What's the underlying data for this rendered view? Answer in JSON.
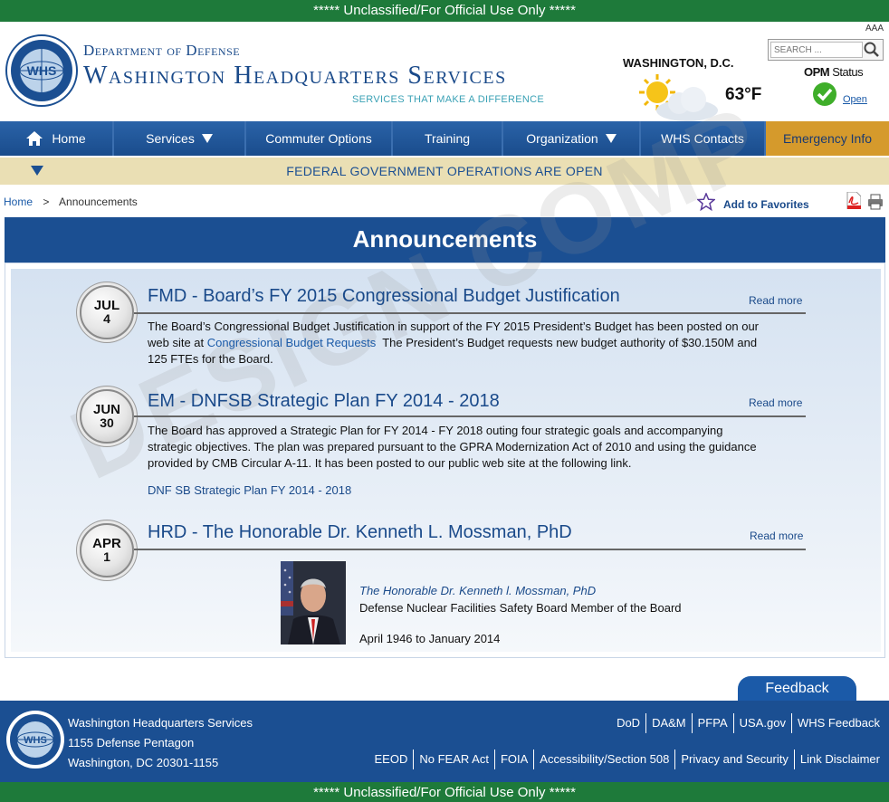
{
  "classification": "***** Unclassified/For Official Use Only *****",
  "header": {
    "dept": "Department of Defense",
    "title": "Washington Headquarters Services",
    "tagline": "SERVICES THAT MAKE A DIFFERENCE",
    "text_size": "AAA",
    "search_placeholder": "SEARCH ...",
    "weather": {
      "city": "WASHINGTON, D.C.",
      "temp": "63°F"
    },
    "opm": {
      "label": "OPM",
      "status_word": "Status",
      "value": "Open"
    }
  },
  "nav": {
    "items": [
      {
        "label": "Home",
        "width": 126
      },
      {
        "label": "Services",
        "width": 146
      },
      {
        "label": "Commuter Options",
        "width": 162
      },
      {
        "label": "Training",
        "width": 122
      },
      {
        "label": "Organization",
        "width": 152
      },
      {
        "label": "WHS Contacts",
        "width": 138
      },
      {
        "label": "Emergency Info",
        "width": 136
      }
    ]
  },
  "status_bar": "FEDERAL GOVERNMENT OPERATIONS ARE OPEN",
  "breadcrumb": {
    "home": "Home",
    "sep": ">",
    "current": "Announcements"
  },
  "favorites_label": "Add to Favorites",
  "panel_title": "Announcements",
  "watermark": "DESIGN COMP",
  "announcements": [
    {
      "month": "JUL",
      "day": "4",
      "title": "FMD - Board’s FY 2015 Congressional Budget Justification",
      "read_more": "Read more",
      "line1": "The Board’s Congressional Budget Justification in support of the FY 2015 President’s Budget has been posted on our",
      "line2_pre": "web site at ",
      "line2_link": "Congressional Budget Requests",
      "line2_post": "  The President’s Budget requests new budget authority of $30.150M and",
      "line3": "125 FTEs for the Board."
    },
    {
      "month": "JUN",
      "day": "30",
      "title": "EM - DNFSB Strategic Plan FY 2014 - 2018",
      "read_more": "Read more",
      "line1": "The Board has approved a Strategic Plan for FY 2014 - FY 2018 outing four strategic goals and accompanying",
      "line2": "strategic objectives. The plan was prepared pursuant to the GPRA Modernization Act of 2010 and using the guidance",
      "line3": "provided by CMB Circular A-11. It has been posted to our public web site at the following link.",
      "link": "DNF SB Strategic Plan FY 2014 - 2018"
    },
    {
      "month": "APR",
      "day": "1",
      "title": "HRD - The Honorable Dr. Kenneth L. Mossman,  PhD",
      "read_more": "Read more",
      "bio_name": "The Honorable Dr. Kenneth l. Mossman, PhD",
      "bio_role": "Defense Nuclear Facilities Safety Board Member of the Board",
      "bio_dates": "April 1946 to January 2014"
    }
  ],
  "feedback": "Feedback",
  "footer": {
    "addr1": "Washington Headquarters Services",
    "addr2": "1155 Defense Pentagon",
    "addr3": "Washington, DC 20301-1155",
    "links_top": [
      "DoD",
      "DA&M",
      "PFPA",
      "USA.gov",
      "WHS Feedback"
    ],
    "links_bottom": [
      "EEOD",
      "No FEAR Act",
      "FOIA",
      "Accessibility/Section 508",
      "Privacy and Security",
      "Link Disclaimer"
    ]
  },
  "colors": {
    "brand_blue": "#1b4f92",
    "class_green": "#1e7a3a",
    "emergency_gold": "#d59a2c",
    "status_tan": "#eadfb4"
  }
}
